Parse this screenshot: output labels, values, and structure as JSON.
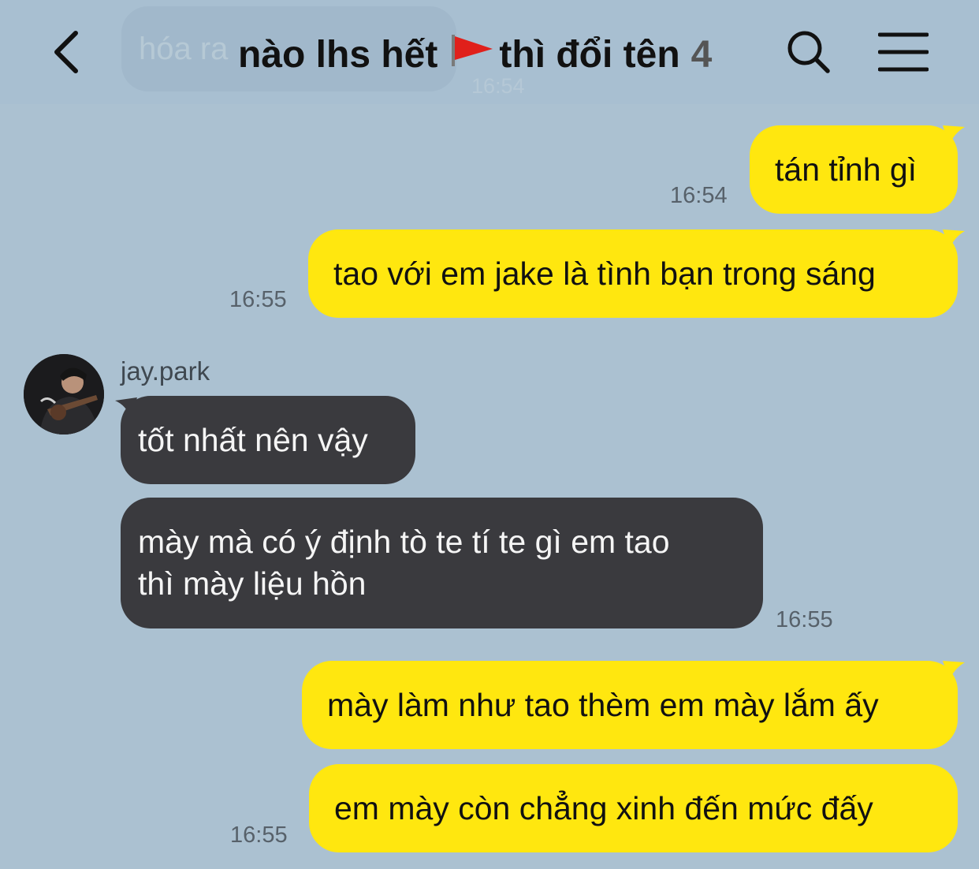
{
  "header": {
    "back_icon": "chevron-left-icon",
    "title_part1": "nào lhs hết",
    "title_flag_icon": "red-flag-icon",
    "title_part2": "thì đổi tên",
    "member_count": "4",
    "search_icon": "search-icon",
    "menu_icon": "hamburger-menu-icon",
    "ghost_message": "hóa ra",
    "ghost_time": "16:54"
  },
  "colors": {
    "background": "#abc1d1",
    "outgoing_bubble": "#ffe70f",
    "incoming_bubble": "#3a3a3e",
    "time_text": "#57616a"
  },
  "messages": [
    {
      "direction": "out",
      "text": "tán tỉnh gì",
      "time": "16:54"
    },
    {
      "direction": "out",
      "text": "tao với em jake là tình bạn trong sáng",
      "time": "16:55"
    },
    {
      "direction": "in",
      "sender": "jay.park",
      "text": "tốt nhất nên vậy",
      "time": ""
    },
    {
      "direction": "in",
      "sender": "jay.park",
      "text_line1": "mày mà có ý định tò te tí te gì em tao",
      "text_line2": "thì mày liệu hồn",
      "time": "16:55"
    },
    {
      "direction": "out",
      "text": "mày làm như tao thèm em mày lắm ấy",
      "time": ""
    },
    {
      "direction": "out",
      "text": "em mày còn chẳng xinh đến mức đấy",
      "time": "16:55"
    }
  ]
}
